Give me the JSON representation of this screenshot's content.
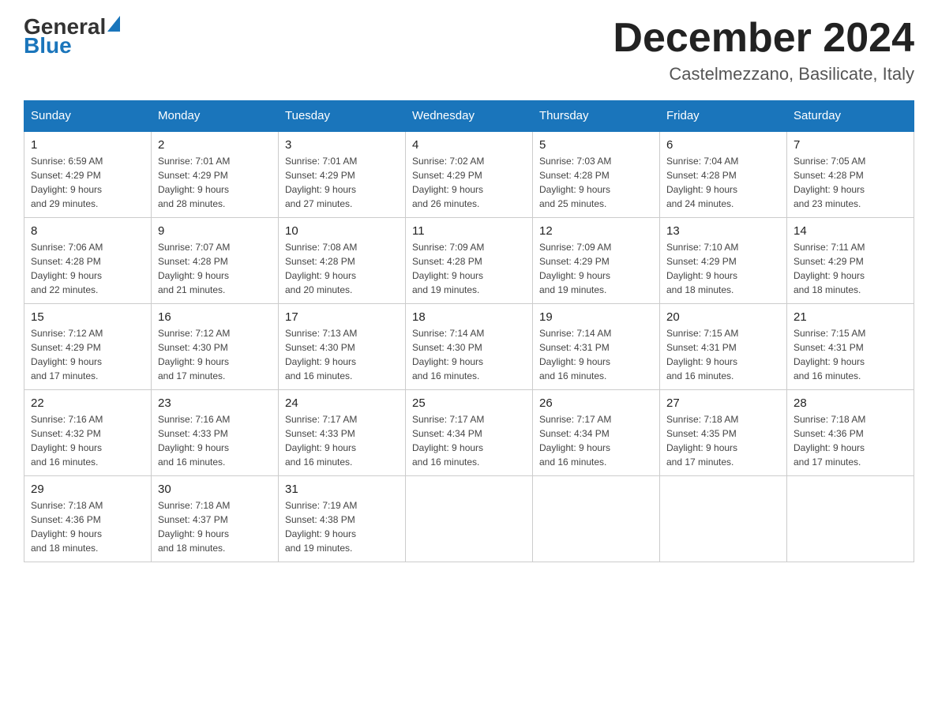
{
  "header": {
    "logo": {
      "general": "General",
      "blue": "Blue",
      "arrow": "▲"
    },
    "title": "December 2024",
    "location": "Castelmezzano, Basilicate, Italy"
  },
  "weekdays": [
    "Sunday",
    "Monday",
    "Tuesday",
    "Wednesday",
    "Thursday",
    "Friday",
    "Saturday"
  ],
  "weeks": [
    [
      {
        "day": "1",
        "info": "Sunrise: 6:59 AM\nSunset: 4:29 PM\nDaylight: 9 hours\nand 29 minutes."
      },
      {
        "day": "2",
        "info": "Sunrise: 7:01 AM\nSunset: 4:29 PM\nDaylight: 9 hours\nand 28 minutes."
      },
      {
        "day": "3",
        "info": "Sunrise: 7:01 AM\nSunset: 4:29 PM\nDaylight: 9 hours\nand 27 minutes."
      },
      {
        "day": "4",
        "info": "Sunrise: 7:02 AM\nSunset: 4:29 PM\nDaylight: 9 hours\nand 26 minutes."
      },
      {
        "day": "5",
        "info": "Sunrise: 7:03 AM\nSunset: 4:28 PM\nDaylight: 9 hours\nand 25 minutes."
      },
      {
        "day": "6",
        "info": "Sunrise: 7:04 AM\nSunset: 4:28 PM\nDaylight: 9 hours\nand 24 minutes."
      },
      {
        "day": "7",
        "info": "Sunrise: 7:05 AM\nSunset: 4:28 PM\nDaylight: 9 hours\nand 23 minutes."
      }
    ],
    [
      {
        "day": "8",
        "info": "Sunrise: 7:06 AM\nSunset: 4:28 PM\nDaylight: 9 hours\nand 22 minutes."
      },
      {
        "day": "9",
        "info": "Sunrise: 7:07 AM\nSunset: 4:28 PM\nDaylight: 9 hours\nand 21 minutes."
      },
      {
        "day": "10",
        "info": "Sunrise: 7:08 AM\nSunset: 4:28 PM\nDaylight: 9 hours\nand 20 minutes."
      },
      {
        "day": "11",
        "info": "Sunrise: 7:09 AM\nSunset: 4:28 PM\nDaylight: 9 hours\nand 19 minutes."
      },
      {
        "day": "12",
        "info": "Sunrise: 7:09 AM\nSunset: 4:29 PM\nDaylight: 9 hours\nand 19 minutes."
      },
      {
        "day": "13",
        "info": "Sunrise: 7:10 AM\nSunset: 4:29 PM\nDaylight: 9 hours\nand 18 minutes."
      },
      {
        "day": "14",
        "info": "Sunrise: 7:11 AM\nSunset: 4:29 PM\nDaylight: 9 hours\nand 18 minutes."
      }
    ],
    [
      {
        "day": "15",
        "info": "Sunrise: 7:12 AM\nSunset: 4:29 PM\nDaylight: 9 hours\nand 17 minutes."
      },
      {
        "day": "16",
        "info": "Sunrise: 7:12 AM\nSunset: 4:30 PM\nDaylight: 9 hours\nand 17 minutes."
      },
      {
        "day": "17",
        "info": "Sunrise: 7:13 AM\nSunset: 4:30 PM\nDaylight: 9 hours\nand 16 minutes."
      },
      {
        "day": "18",
        "info": "Sunrise: 7:14 AM\nSunset: 4:30 PM\nDaylight: 9 hours\nand 16 minutes."
      },
      {
        "day": "19",
        "info": "Sunrise: 7:14 AM\nSunset: 4:31 PM\nDaylight: 9 hours\nand 16 minutes."
      },
      {
        "day": "20",
        "info": "Sunrise: 7:15 AM\nSunset: 4:31 PM\nDaylight: 9 hours\nand 16 minutes."
      },
      {
        "day": "21",
        "info": "Sunrise: 7:15 AM\nSunset: 4:31 PM\nDaylight: 9 hours\nand 16 minutes."
      }
    ],
    [
      {
        "day": "22",
        "info": "Sunrise: 7:16 AM\nSunset: 4:32 PM\nDaylight: 9 hours\nand 16 minutes."
      },
      {
        "day": "23",
        "info": "Sunrise: 7:16 AM\nSunset: 4:33 PM\nDaylight: 9 hours\nand 16 minutes."
      },
      {
        "day": "24",
        "info": "Sunrise: 7:17 AM\nSunset: 4:33 PM\nDaylight: 9 hours\nand 16 minutes."
      },
      {
        "day": "25",
        "info": "Sunrise: 7:17 AM\nSunset: 4:34 PM\nDaylight: 9 hours\nand 16 minutes."
      },
      {
        "day": "26",
        "info": "Sunrise: 7:17 AM\nSunset: 4:34 PM\nDaylight: 9 hours\nand 16 minutes."
      },
      {
        "day": "27",
        "info": "Sunrise: 7:18 AM\nSunset: 4:35 PM\nDaylight: 9 hours\nand 17 minutes."
      },
      {
        "day": "28",
        "info": "Sunrise: 7:18 AM\nSunset: 4:36 PM\nDaylight: 9 hours\nand 17 minutes."
      }
    ],
    [
      {
        "day": "29",
        "info": "Sunrise: 7:18 AM\nSunset: 4:36 PM\nDaylight: 9 hours\nand 18 minutes."
      },
      {
        "day": "30",
        "info": "Sunrise: 7:18 AM\nSunset: 4:37 PM\nDaylight: 9 hours\nand 18 minutes."
      },
      {
        "day": "31",
        "info": "Sunrise: 7:19 AM\nSunset: 4:38 PM\nDaylight: 9 hours\nand 19 minutes."
      },
      {
        "day": "",
        "info": ""
      },
      {
        "day": "",
        "info": ""
      },
      {
        "day": "",
        "info": ""
      },
      {
        "day": "",
        "info": ""
      }
    ]
  ]
}
